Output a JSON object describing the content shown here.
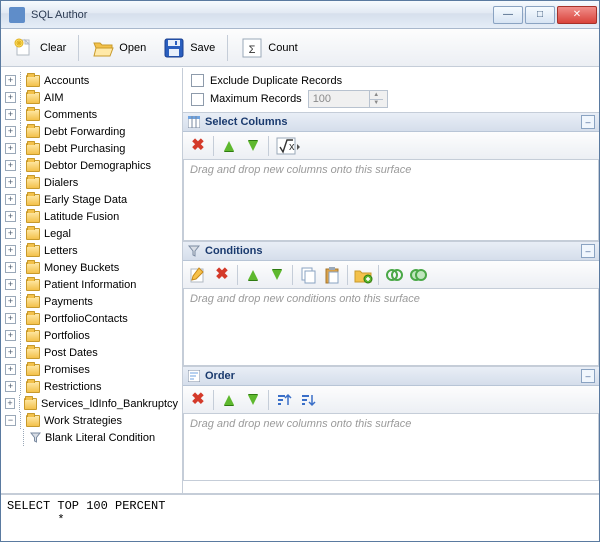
{
  "window": {
    "title": "SQL Author"
  },
  "toolbar": {
    "clear": "Clear",
    "open": "Open",
    "save": "Save",
    "count": "Count"
  },
  "tree": {
    "items": [
      "Accounts",
      "AIM",
      "Comments",
      "Debt Forwarding",
      "Debt Purchasing",
      "Debtor Demographics",
      "Dialers",
      "Early Stage Data",
      "Latitude Fusion",
      "Legal",
      "Letters",
      "Money Buckets",
      "Patient Information",
      "Payments",
      "PortfolioContacts",
      "Portfolios",
      "Post Dates",
      "Promises",
      "Restrictions",
      "Services_IdInfo_Bankruptcy",
      "Work Strategies"
    ],
    "leaf": "Blank Literal Condition"
  },
  "options": {
    "exclude_dup": "Exclude Duplicate Records",
    "max_records": "Maximum Records",
    "max_value": "100"
  },
  "panels": {
    "select": {
      "title": "Select Columns",
      "placeholder": "Drag and drop new columns onto this surface"
    },
    "conditions": {
      "title": "Conditions",
      "placeholder": "Drag and drop new conditions onto this surface"
    },
    "order": {
      "title": "Order",
      "placeholder": "Drag and drop new columns onto this surface"
    }
  },
  "sql": "SELECT TOP 100 PERCENT\n       *"
}
